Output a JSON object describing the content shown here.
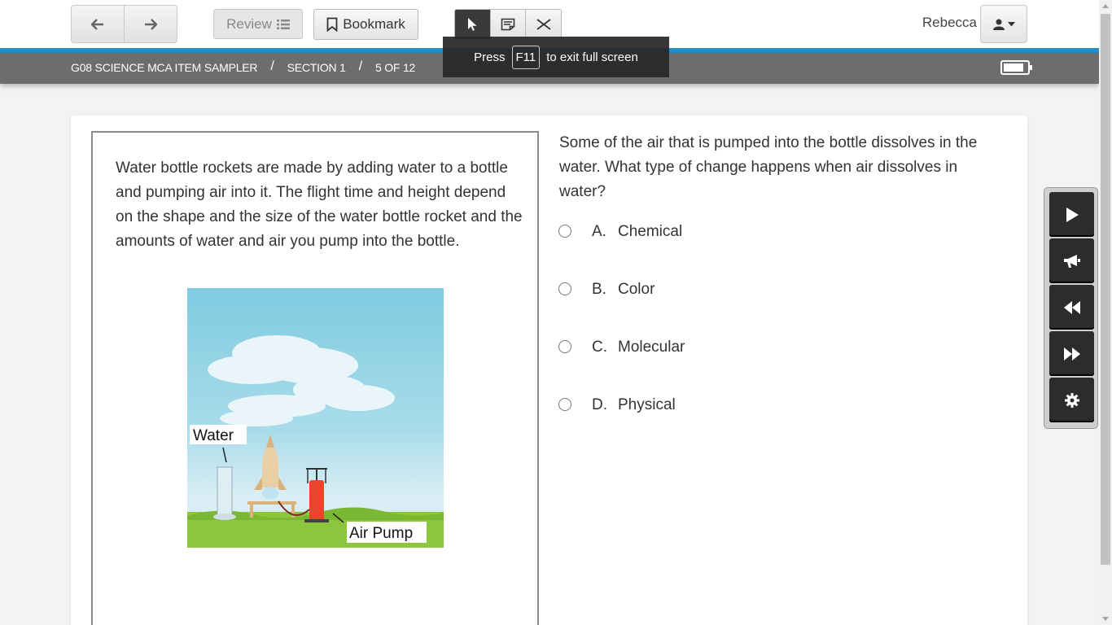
{
  "header": {
    "review_label": "Review",
    "bookmark_label": "Bookmark",
    "username": "Rebecca"
  },
  "toast": {
    "prefix": "Press",
    "key": "F11",
    "suffix": "to exit full screen"
  },
  "breadcrumb": {
    "test": "G08 SCIENCE MCA ITEM SAMPLER",
    "separator": "/",
    "section": "SECTION 1",
    "position": "5 OF 12"
  },
  "passage": {
    "text": "Water bottle rockets are made by adding water to a bottle and pumping air into it. The flight time and height depend on the shape and the size of the water bottle rocket and the amounts of water and air you pump into the bottle.",
    "figure_labels": {
      "water": "Water",
      "pump": "Air Pump"
    }
  },
  "question": {
    "stem": "Some of the air that is pumped into the bottle dissolves in the water. What type of change happens when air dissolves in water?",
    "options": [
      {
        "letter": "A.",
        "text": "Chemical"
      },
      {
        "letter": "B.",
        "text": "Color"
      },
      {
        "letter": "C.",
        "text": "Molecular"
      },
      {
        "letter": "D.",
        "text": "Physical"
      }
    ]
  },
  "icons": {
    "back": "arrow-left-icon",
    "forward": "arrow-right-icon",
    "review": "list-icon",
    "bookmark": "bookmark-icon",
    "pointer": "pointer-icon",
    "note": "note-icon",
    "close": "close-icon",
    "user": "user-icon",
    "play": "play-icon",
    "speak": "megaphone-icon",
    "rewind": "rewind-icon",
    "fastforward": "fast-forward-icon",
    "settings": "gear-icon",
    "battery": "battery-icon"
  },
  "colors": {
    "accent": "#1f8fd0",
    "crumbbar": "#6d6d6d",
    "tool_dark": "#2c2c2c"
  }
}
